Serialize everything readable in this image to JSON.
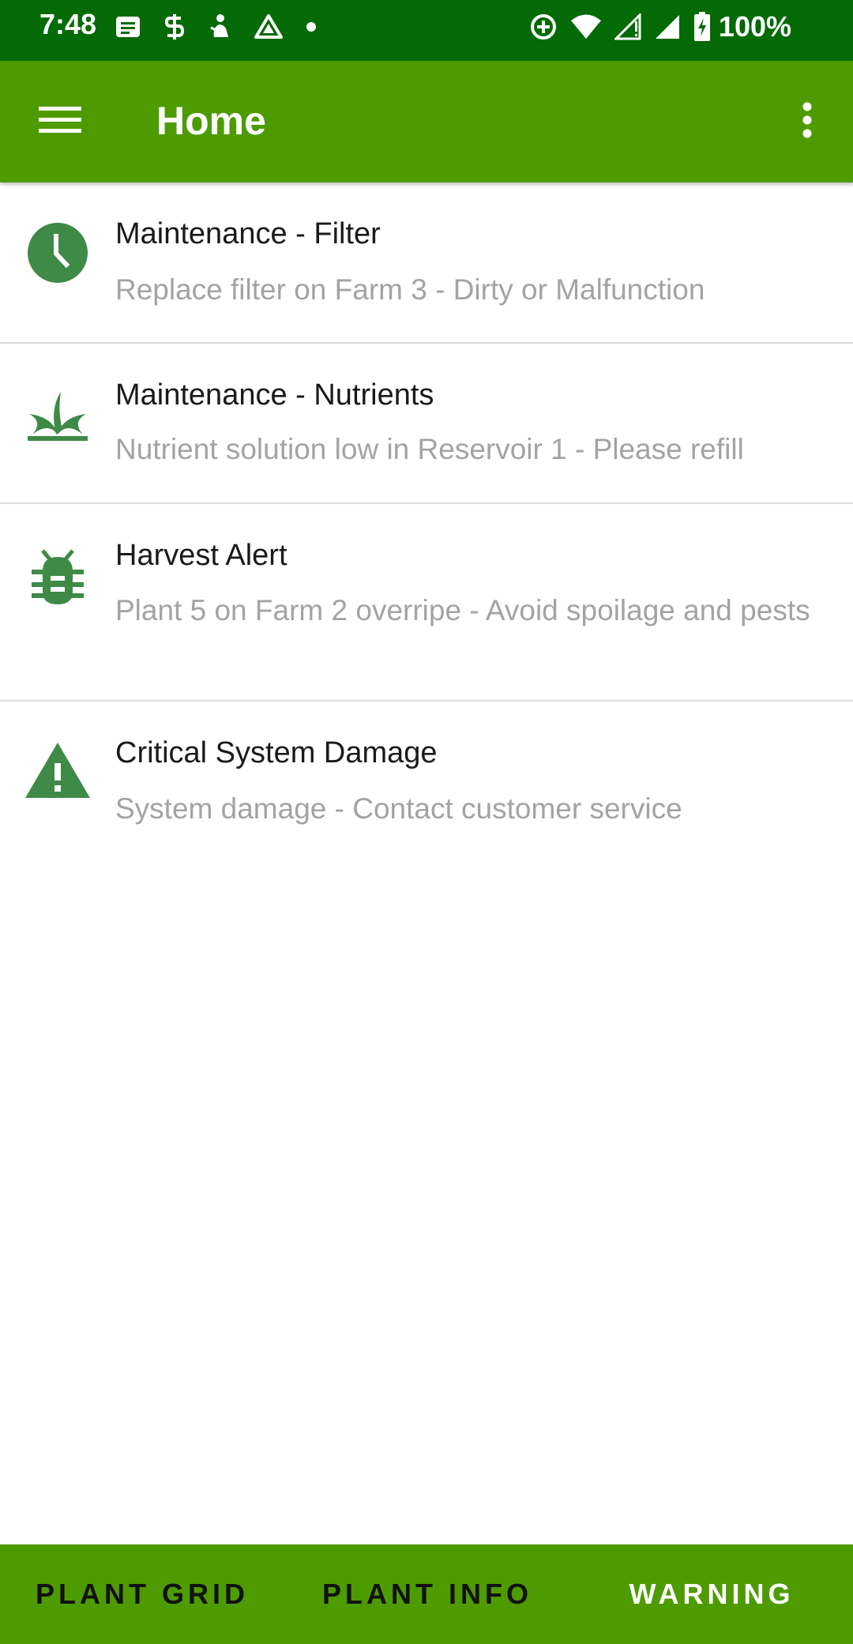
{
  "status_bar": {
    "time": "7:48",
    "battery": "100%",
    "left_icons": [
      "message-icon",
      "s-app-icon",
      "figure-icon",
      "drive-icon",
      "dot-icon"
    ],
    "right_icons": [
      "data-saver-icon",
      "wifi-icon",
      "signal-alert-icon",
      "signal-icon",
      "battery-charging-icon"
    ]
  },
  "app_bar": {
    "title": "Home",
    "background_color": "#4e9b01"
  },
  "alerts": [
    {
      "title": "Maintenance - Filter",
      "description": "Replace filter on Farm 3 - Dirty or Malfunction",
      "icon": "clock-icon"
    },
    {
      "title": "Maintenance - Nutrients",
      "description": "Nutrient solution low in Reservoir 1 - Please refill",
      "icon": "grass-icon"
    },
    {
      "title": "Harvest Alert",
      "description": "Plant 5 on Farm 2 overripe - Avoid spoilage and pests",
      "icon": "bug-icon"
    },
    {
      "title": "Critical System Damage",
      "description": "System damage - Contact customer service",
      "icon": "warning-icon"
    }
  ],
  "bottom_nav": {
    "tabs": [
      {
        "label": "PLANT GRID",
        "active": false
      },
      {
        "label": "PLANT INFO",
        "active": false
      },
      {
        "label": "WARNING",
        "active": true
      }
    ]
  },
  "colors": {
    "status_bar": "#036a05",
    "primary": "#4e9b01",
    "icon_green": "#3e8a46",
    "subtitle_gray": "#a3a3a3"
  }
}
